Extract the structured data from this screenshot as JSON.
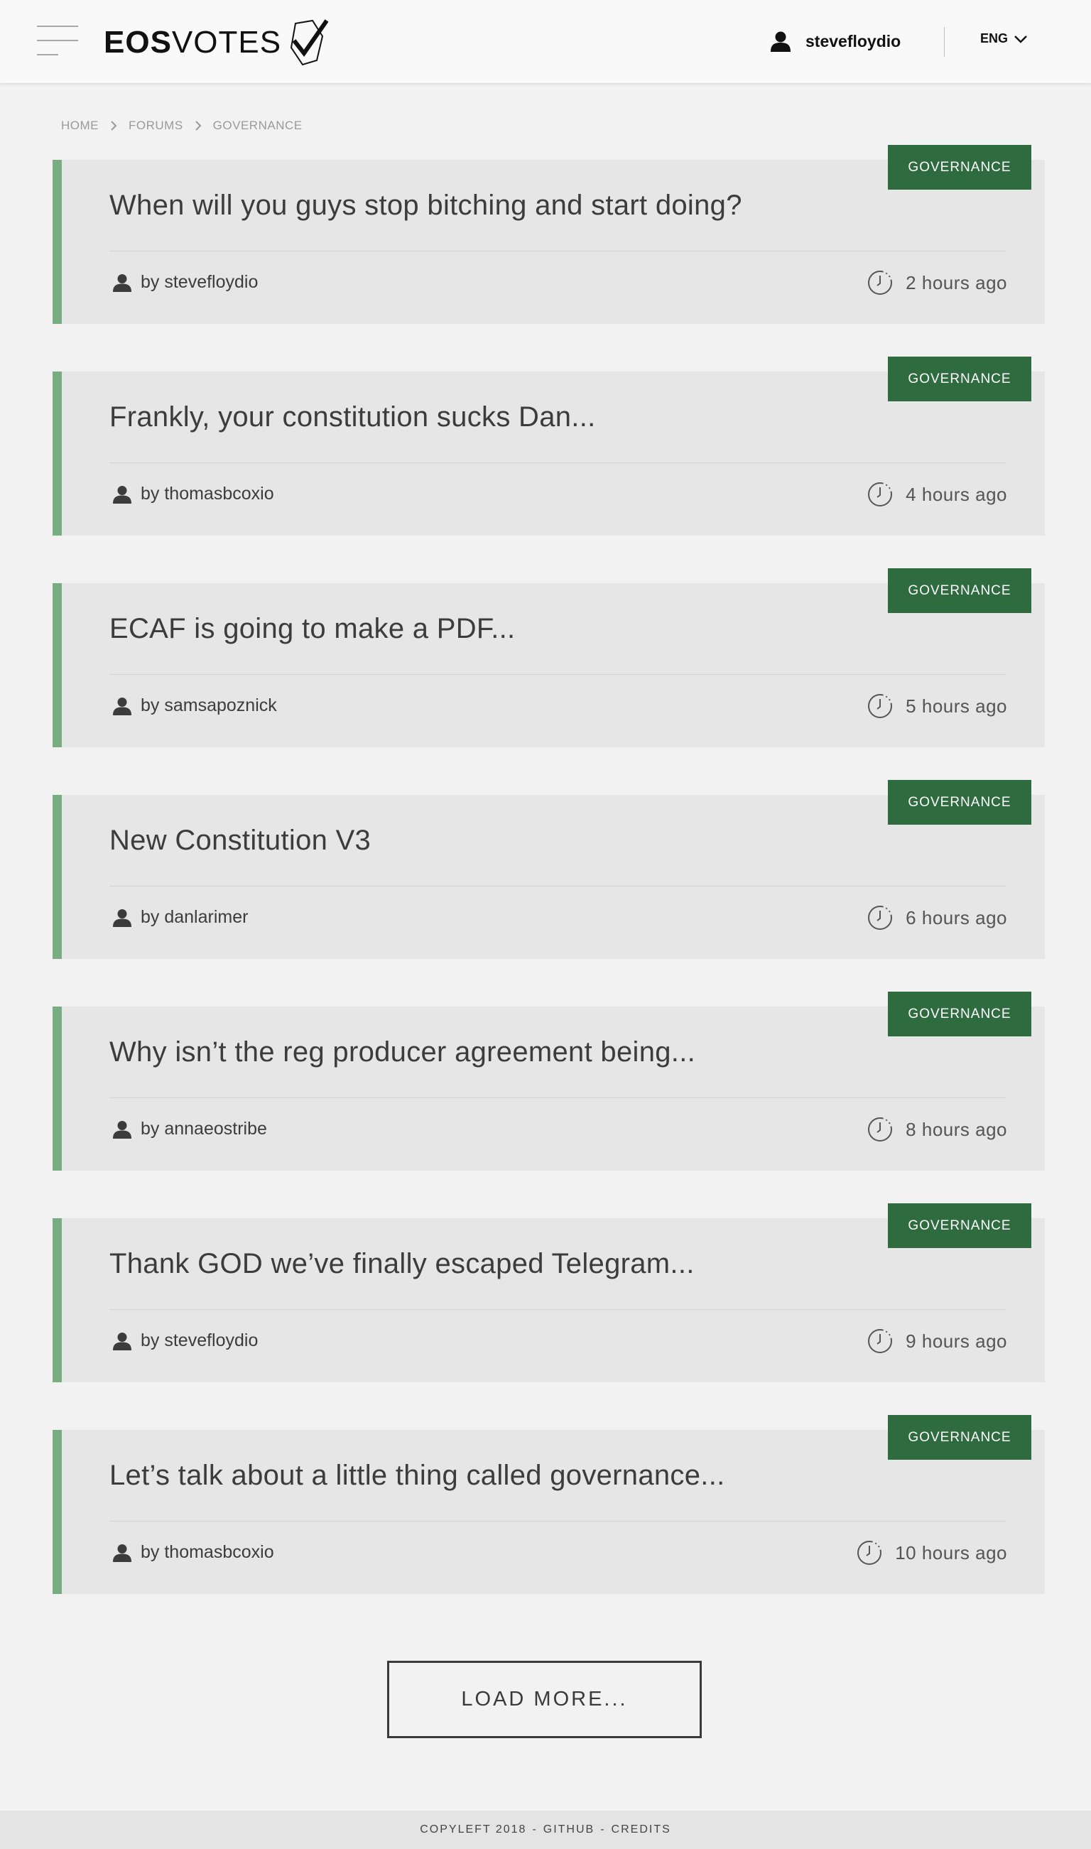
{
  "header": {
    "logo_bold": "EOS",
    "logo_light": "VOTES",
    "user_name": "stevefloydio",
    "language": "ENG"
  },
  "breadcrumb": {
    "items": [
      "HOME",
      "FORUMS",
      "GOVERNANCE"
    ]
  },
  "posts": [
    {
      "tag": "GOVERNANCE",
      "title": "When will you guys stop bitching and start doing?",
      "author": "by stevefloydio",
      "time": "2 hours ago"
    },
    {
      "tag": "GOVERNANCE",
      "title": "Frankly, your constitution sucks Dan...",
      "author": "by thomasbcoxio",
      "time": "4 hours ago"
    },
    {
      "tag": "GOVERNANCE",
      "title": "ECAF is going to make a PDF...",
      "author": "by samsapoznick",
      "time": "5 hours ago"
    },
    {
      "tag": "GOVERNANCE",
      "title": "New Constitution V3",
      "author": "by danlarimer",
      "time": "6 hours ago"
    },
    {
      "tag": "GOVERNANCE",
      "title": "Why isn’t the reg producer agreement being...",
      "author": "by annaeostribe",
      "time": "8 hours ago"
    },
    {
      "tag": "GOVERNANCE",
      "title": "Thank GOD we’ve finally escaped Telegram...",
      "author": "by stevefloydio",
      "time": "9 hours ago"
    },
    {
      "tag": "GOVERNANCE",
      "title": "Let’s talk about a little thing called governance...",
      "author": "by thomasbcoxio",
      "time": "10 hours ago"
    }
  ],
  "load_more_label": "LOAD MORE...",
  "footer": {
    "copyleft": "COPYLEFT 2018",
    "github": "GITHUB",
    "credits": "CREDITS",
    "separator": "-"
  },
  "colors": {
    "accent_bar": "#7aac82",
    "tag_bg": "#2e6b3e",
    "card_bg": "#e6e6e6",
    "page_bg": "#f2f2f2"
  },
  "icons": [
    "menu-icon",
    "logo-checkmark-icon",
    "user-icon",
    "chevron-down-icon",
    "chevron-right-icon",
    "clock-icon"
  ]
}
